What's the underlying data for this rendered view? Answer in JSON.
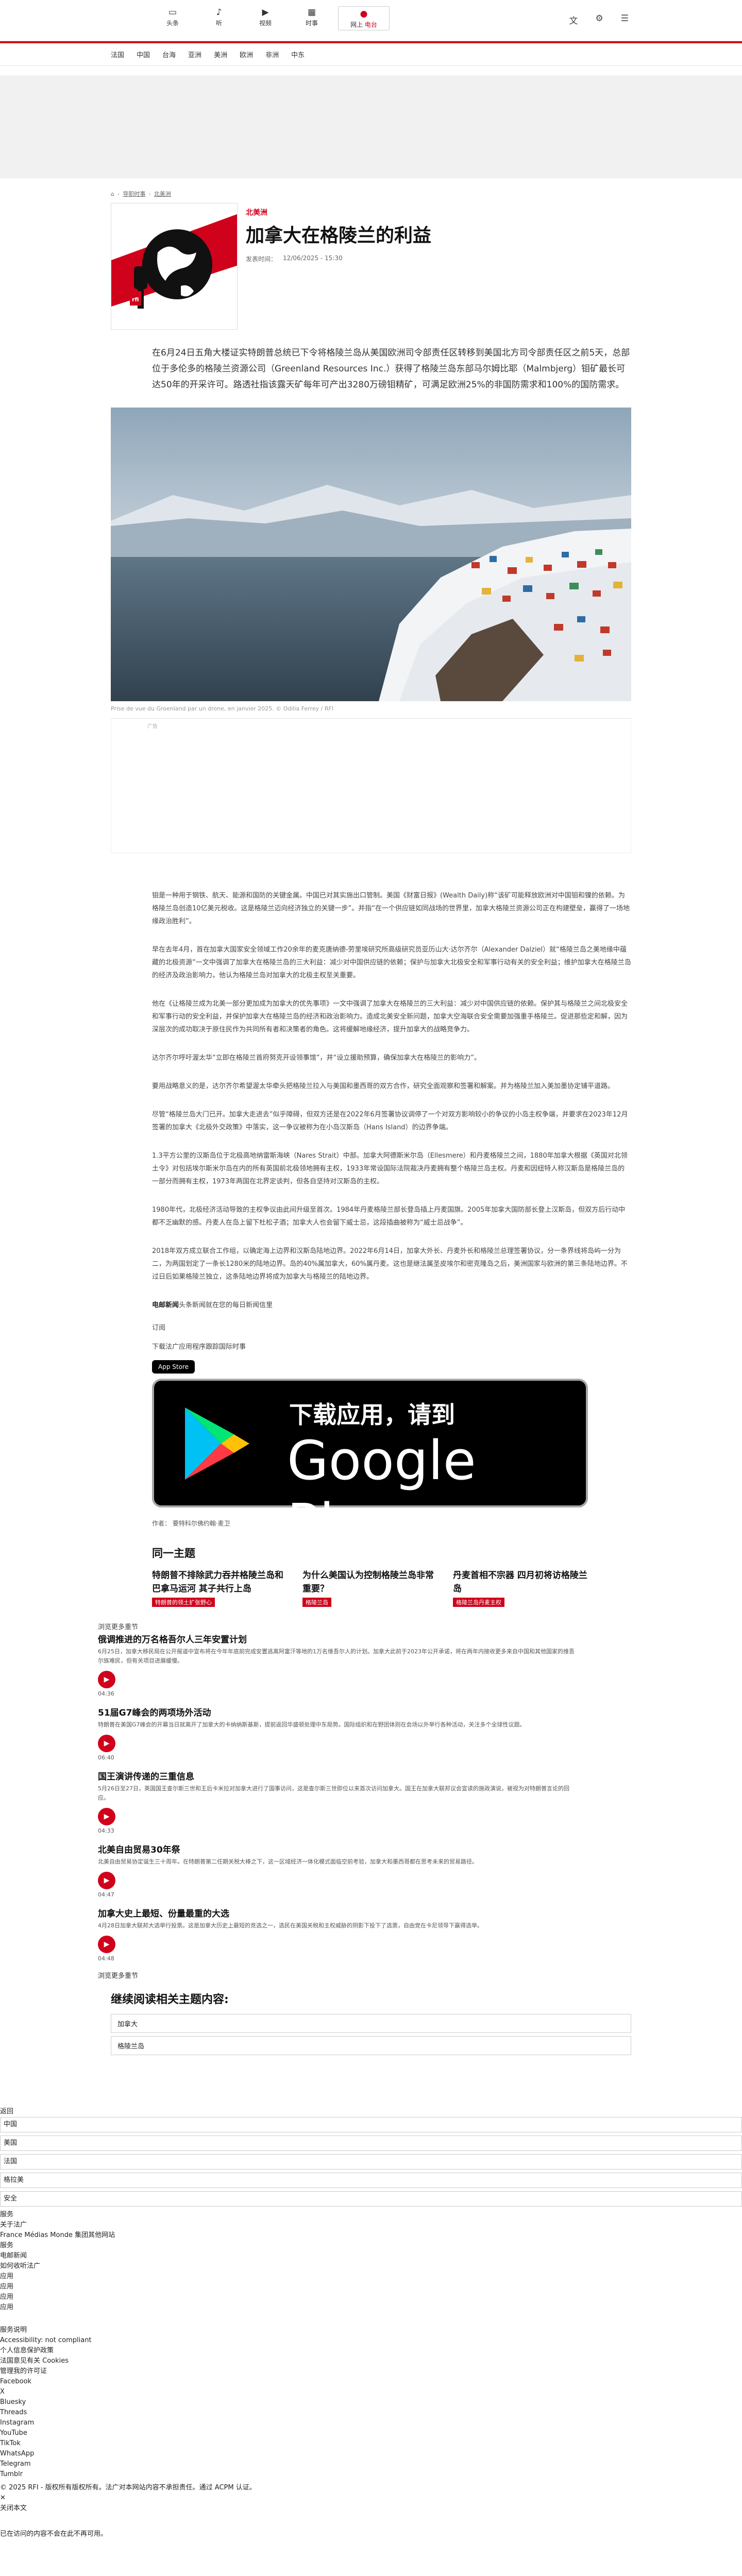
{
  "topnav": [
    {
      "icon": "tv-icon",
      "glyph": "▭",
      "label": "头条"
    },
    {
      "icon": "bell-icon",
      "glyph": "♪",
      "label": "听"
    },
    {
      "icon": "play-icon",
      "glyph": "▶",
      "label": "视频"
    },
    {
      "icon": "calendar-icon",
      "glyph": "▦",
      "label": "时事"
    }
  ],
  "live": {
    "prefix": "网上",
    "label": "电台"
  },
  "sections": [
    "法国",
    "中国",
    "台海",
    "亚洲",
    "美洲",
    "欧洲",
    "非洲",
    "中东"
  ],
  "breadcrumb": {
    "home": "⌂",
    "a": "导职时事",
    "b": "北美洲"
  },
  "article": {
    "kicker": "北美洲",
    "title": "加拿大在格陵兰的利益",
    "date_label": "发表时间：",
    "date": "12/06/2025 - 15:30",
    "lede": "在6月24日五角大楼证实特朗普总统已下令将格陵兰岛从美国欧洲司令部责任区转移到美国北方司令部责任区之前5天，总部位于多伦多的格陵兰资源公司（Greenland Resources Inc.）获得了格陵兰岛东部马尔姆比耶（Malmbjerg）钼矿最长可达50年的开采许可。路透社指该露天矿每年可产出3280万磅钼精矿，可满足欧洲25%的非国防需求和100%的国防需求。",
    "caption": "Prise de vue du Groenland par un drone, en janvier 2025. © Odilia Ferrey / RFI",
    "ad_label": "广告",
    "paragraphs": [
      "钼是一种用于钢铁、航天、能源和国防的关键金属。中国已对其实施出口管制。美国《财富日报》(Wealth Daily)称“该矿可能释放欧洲对中国钼和镍的依赖。为格陵兰岛创造10亿美元税收。这是格陵兰迈向经济独立的关键一步”。并指“在一个供应链如同战场的世界里，加拿大格陵兰资源公司正在构建壁垒，赢得了一场地缘政治胜利”。",
      "早在去年4月，首在加拿大国家安全领域工作20余年的麦克唐纳德-劳里埃研究所高级研究员亚历山大·达尔齐尔（Alexander Dalziel）就“格陵兰岛之美地缘中蕴藏的北极资源”一文中强调了加拿大在格陵兰岛的三大利益：减少对中国供应链的依赖；保护与加拿大北极安全和军事行动有关的安全利益；维护加拿大在格陵兰岛的经济及政治影响力，他认为格陵兰岛对加拿大的北极主权至关重要。",
      "他在《让格陵兰成为北美一部分更加成为加拿大的优先事项》一文中强调了加拿大在格陵兰的三大利益：减少对中国供应链的依赖。保护其与格陵兰之间北极安全和军事行动的安全利益，并保护加拿大在格陵兰岛的经济和政治影响力。造成北美安全新问题，加拿大空海联合安全需要加强重手格陵兰。促进那些定和解，因为深层次的成功取决于原住民作为共同所有者和决策者的角色。这将缓解地缘经济，提升加拿大的战略竞争力。",
      "达尔齐尔呼吁渥太华“立即在格陵兰首府努克开设领事馆”，并“设立援助预算，确保加拿大在格陵兰的影响力”。",
      "要用战略意义的是，达尔齐尔希望渥太华牵头把格陵兰拉入与美国和墨西哥的双方合作，研究全面观察和签署和解案。并为格陵兰加入美加墨协定铺平道路。",
      "尽管“格陵兰岛大门已开。加拿大走进去”似乎障碍，但双方还是在2022年6月签署协议调停了一个对双方影响较小的争议的小岛主权争端，并要求在2023年12月签署的加拿大《北极外交政策》中落实，这一争议被称为在小岛汉斯岛（Hans Island）的边界争端。",
      "1.3平方公里的汉斯岛位于北极高地纳雷斯海峡（Nares Strait）中部。加拿大阿德斯米尔岛（Ellesmere）和丹麦格陵兰之间，1880年加拿大根据《英国对北领土令》对包括埃尔斯米尔岛在内的所有英国前北极领地拥有主权，1933年常设国际法院裁决丹麦拥有整个格陵兰岛主权。丹麦和因纽特人称汉斯岛是格陵兰岛的一部分而拥有主权，1973年两国在北界定谈判，但各自坚持对汉斯岛的主权。",
      "1980年代，北极经济活动导致的主权争议由此间升级至首次。1984年丹麦格陵兰部长登岛插上丹麦国旗。2005年加拿大国防部长登上汉斯岛，但双方后行动中都不乏幽默的感。丹麦人在岛上留下杜松子酒；加拿大人也会留下威士忌，这段插曲被称为“威士忌战争”。",
      "2018年双方成立联合工作组，以确定海上边界和汉斯岛陆地边界。2022年6月14日，加拿大外长、丹麦外长和格陵兰总理签署协议，分一条界线将岛屿一分为二，为两国划定了一条长1280米的陆地边界。岛的40%属加拿大，60%属丹麦。这也是继法属圣皮埃尔和密克隆岛之后，美洲国家与欧洲的第三条陆地边界。不过日后如果格陵兰独立，这条陆地边界将成为加拿大与格陵兰的陆地边界。"
    ],
    "note_prefix": "电邮新闻",
    "note_text": "头条新闻就在您的每日新闻信里",
    "subscribe": "订阅",
    "download_line": "下载法广应用程序跟踪国际时事",
    "appstore": "App Store",
    "gplay_1": "下载应用，请到",
    "gplay_2": "Google Play",
    "authors": "作者：  要特科尔佛约翰·麦卫"
  },
  "same_topic": {
    "title": "同一主题",
    "items": [
      {
        "h": "特朗普不排除武力吞并格陵兰岛和巴拿马运河 其子共行上岛",
        "tag": "特朗普的领土扩张野心"
      },
      {
        "h": "为什么美国认为控制格陵兰岛非常重要？",
        "tag": "格陵兰岛"
      },
      {
        "h": "丹麦首相不宗器 四月初将访格陵兰岛",
        "tag": "格陵兰岛丹麦主权"
      }
    ]
  },
  "podcasts": {
    "top": "浏览更多重节",
    "items": [
      {
        "h": "俄调推进的万名格吾尔人三年安置计划",
        "d": "6月25日，加拿大移民局在公开报道中宣布将在今年年底前完成安置逃离阿富汗等地的1万名维吾尔人的计划。加拿大此前于2023年公开承诺，将在两年内接收更多来自中国和其他国家的维吾尔族难民，但有关项目进展缓慢。",
        "dur": "04:36"
      },
      {
        "h": "51届G7峰会的两项场外活动",
        "d": "特朗普在美国G7峰会的开幕当日就离开了加拿大的卡纳纳斯基斯，提前返回华盛顿处理中东局势。国际组织和在野团体则在会场以外举行各种活动，关注多个全球性议题。",
        "dur": "06:40"
      },
      {
        "h": "国王演讲传递的三重信息",
        "d": "5月26日至27日，英国国王查尔斯三世和王后卡米拉对加拿大进行了国事访问，这是查尔斯三世即位以来首次访问加拿大。国王在加拿大联邦议会宣读的施政演说，被视为对特朗普言论的回应。",
        "dur": "04:33"
      },
      {
        "h": "北美自由贸易30年祭",
        "d": "北美自由贸易协定诞生三十周年。在特朗普第二任期关税大棒之下，这一区域经济一体化模式面临空前考验，加拿大和墨西哥都在思考未来的贸易路径。",
        "dur": "04:47"
      },
      {
        "h": "加拿大史上最短、份量最重的大选",
        "d": "4月28日加拿大联邦大选举行投票。这是加拿大历史上最短的竞选之一，选民在美国关税和主权威胁的阴影下投下了选票，自由党在卡尼领导下赢得选举。",
        "dur": "04:48"
      }
    ],
    "more": "浏览更多重节"
  },
  "continue": {
    "title": "继续阅读相关主题内容:",
    "tags": [
      "加拿大",
      "格陵兰岛"
    ]
  },
  "footer": {
    "header": "返回",
    "rows": [
      "中国",
      "美国",
      "法国",
      "格拉美",
      "安全"
    ],
    "lines": [
      "服务",
      "关于法广",
      "France Médias Monde 集团其他网站",
      "服务",
      "电邮新闻",
      "如何收听法广",
      "应用",
      "应用",
      "应用",
      "应用"
    ],
    "legal": [
      "服务说明",
      "Accessibility: not compliant",
      "个人信息保护政策",
      "法国意见有关 Cookies",
      "管理我的许可证"
    ],
    "social": [
      "Facebook",
      "X",
      "Bluesky",
      "Threads",
      "Instagram",
      "YouTube",
      "TikTok",
      "WhatsApp",
      "Telegram",
      "Tumblr"
    ],
    "copyright": "© 2025 RFI - 版权所有版权所有。法广对本网站内容不承担责任。通过 ACPM 认证。",
    "close": "关闭本文",
    "bottom": "已在访问的内容不会在此不再可用。"
  },
  "colors": {
    "accent": "#d0021b",
    "text": "#222222",
    "muted": "#666666"
  }
}
